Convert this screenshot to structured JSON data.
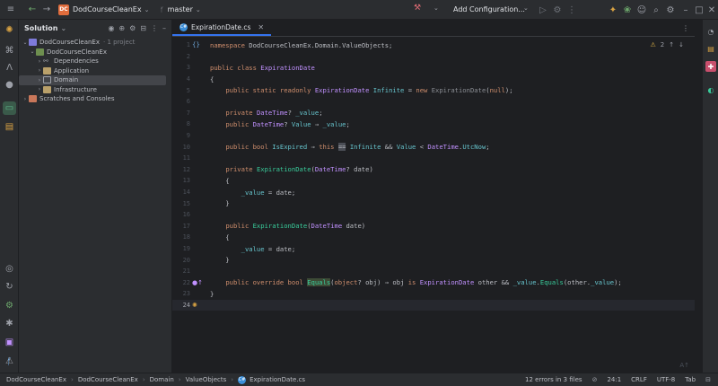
{
  "titlebar": {
    "project_badge": "DC",
    "project_name": "DodCourseCleanEx",
    "branch": "master",
    "run_config": "Add Configuration..."
  },
  "solution": {
    "title": "Solution",
    "items": [
      {
        "label": "DodCourseCleanEx",
        "suffix": "· 1 project"
      },
      {
        "label": "DodCourseCleanEx"
      },
      {
        "label": "Dependencies"
      },
      {
        "label": "Application"
      },
      {
        "label": "Domain"
      },
      {
        "label": "Infrastructure"
      },
      {
        "label": "Scratches and Consoles"
      }
    ]
  },
  "editor": {
    "tab_label": "ExpirationDate.cs",
    "inspections": {
      "warnings": "2"
    },
    "current_line": "22"
  },
  "status": {
    "breadcrumbs": [
      "DodCourseCleanEx",
      "DodCourseCleanEx",
      "Domain",
      "ValueObjects",
      "ExpirationDate.cs"
    ],
    "errors": "12 errors in 3 files",
    "position": "24:1",
    "line_ending": "CRLF",
    "encoding": "UTF-8",
    "indent": "Tab"
  },
  "colors": {
    "accent": "#3574f0",
    "project_badge": "#e06c3c",
    "background": "#1e1f22",
    "panel": "#2b2d30"
  }
}
